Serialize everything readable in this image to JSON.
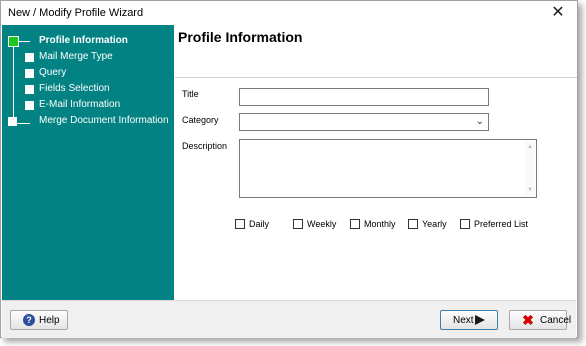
{
  "window": {
    "title": "New / Modify Profile Wizard",
    "close_glyph": "✕"
  },
  "sidebar": {
    "items": [
      {
        "label": "Profile Information",
        "active": true
      },
      {
        "label": "Mail Merge Type",
        "active": false
      },
      {
        "label": "Query",
        "active": false
      },
      {
        "label": "Fields Selection",
        "active": false
      },
      {
        "label": "E-Mail Information",
        "active": false
      },
      {
        "label": "Merge Document Information",
        "active": false
      }
    ],
    "bg_color": "#028283",
    "active_node_color": "#1ec81e"
  },
  "page": {
    "title": "Profile Information"
  },
  "form": {
    "title_label": "Title",
    "title_value": "",
    "category_label": "Category",
    "category_value": "",
    "description_label": "Description",
    "description_value": "",
    "frequency": [
      {
        "label": "Daily",
        "checked": false
      },
      {
        "label": "Weekly",
        "checked": false
      },
      {
        "label": "Monthly",
        "checked": false
      },
      {
        "label": "Yearly",
        "checked": false
      },
      {
        "label": "Preferred List",
        "checked": false
      }
    ]
  },
  "footer": {
    "help_label": "Help",
    "help_icon": "question-icon",
    "next_label": "Next",
    "next_icon": "arrow-right-icon",
    "cancel_label": "Cancel",
    "cancel_icon": "x-icon"
  }
}
